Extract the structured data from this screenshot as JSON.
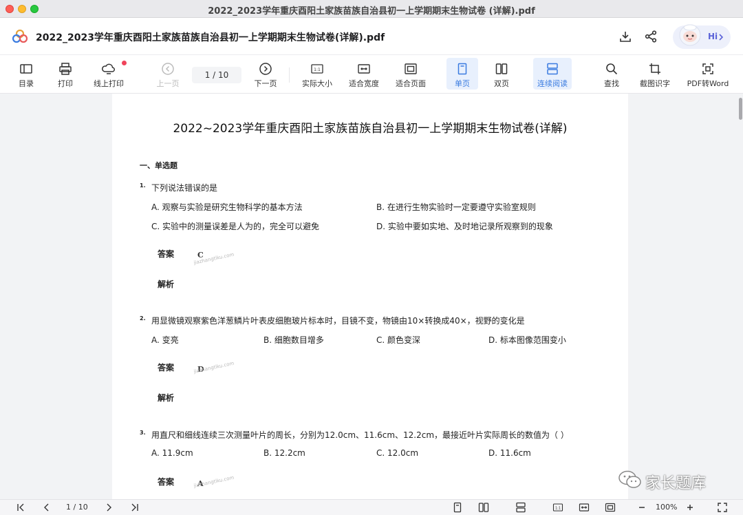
{
  "window": {
    "title": "2022_2023学年重庆酉阳土家族苗族自治县初一上学期期末生物试卷 (详解).pdf"
  },
  "header": {
    "doc_title": "2022_2023学年重庆酉阳土家族苗族自治县初一上学期期末生物试卷(详解).pdf",
    "hi_label": "Hi"
  },
  "toolbar": {
    "toc": "目录",
    "print": "打印",
    "online_print": "线上打印",
    "prev_page": "上一页",
    "page_indicator": "1  /  10",
    "next_page": "下一页",
    "actual_size": "实际大小",
    "fit_width": "适合宽度",
    "fit_page": "适合页面",
    "single_page": "单页",
    "double_page": "双页",
    "continuous": "连续阅读",
    "search": "查找",
    "screenshot_ocr": "截图识字",
    "pdf_to_word": "PDF转Word"
  },
  "document": {
    "title": "2022~2023学年重庆酉阳土家族苗族自治县初一上学期期末生物试卷(详解)",
    "section": "一、单选题",
    "answer_label": "答案",
    "analysis_label": "解析",
    "watermark": "jiazhangtiku.com",
    "questions": [
      {
        "num": "1.",
        "text": "下列说法错误的是",
        "options": [
          "A. 观察与实验是研究生物科学的基本方法",
          "B. 在进行生物实验时一定要遵守实验室规则",
          "C. 实验中的测量误差是人为的，完全可以避免",
          "D. 实验中要如实地、及时地记录所观察到的现象"
        ],
        "answer": "C"
      },
      {
        "num": "2.",
        "text": "用显微镜观察紫色洋葱鳞片叶表皮细胞玻片标本时，目镜不变，物镜由10×转换成40×，视野的变化是",
        "options": [
          "A. 变亮",
          "B. 细胞数目增多",
          "C. 颜色变深",
          "D. 标本图像范围变小"
        ],
        "answer": "D"
      },
      {
        "num": "3.",
        "text": "用直尺和细线连续三次测量叶片的周长，分别为12.0cm、11.6cm、12.2cm，最接近叶片实际周长的数值为（ ）",
        "options": [
          "A. 11.9cm",
          "B. 12.2cm",
          "C. 12.0cm",
          "D. 11.6cm"
        ],
        "answer": "A"
      }
    ]
  },
  "corner_watermark": "家长题库",
  "statusbar": {
    "page_indicator": "1  / 10",
    "zoom": "100%"
  },
  "colors": {
    "accent": "#3a7be0",
    "active_bg": "#e8f0fd",
    "hi_text": "#5b63d8",
    "notify_dot": "#f0445a"
  }
}
